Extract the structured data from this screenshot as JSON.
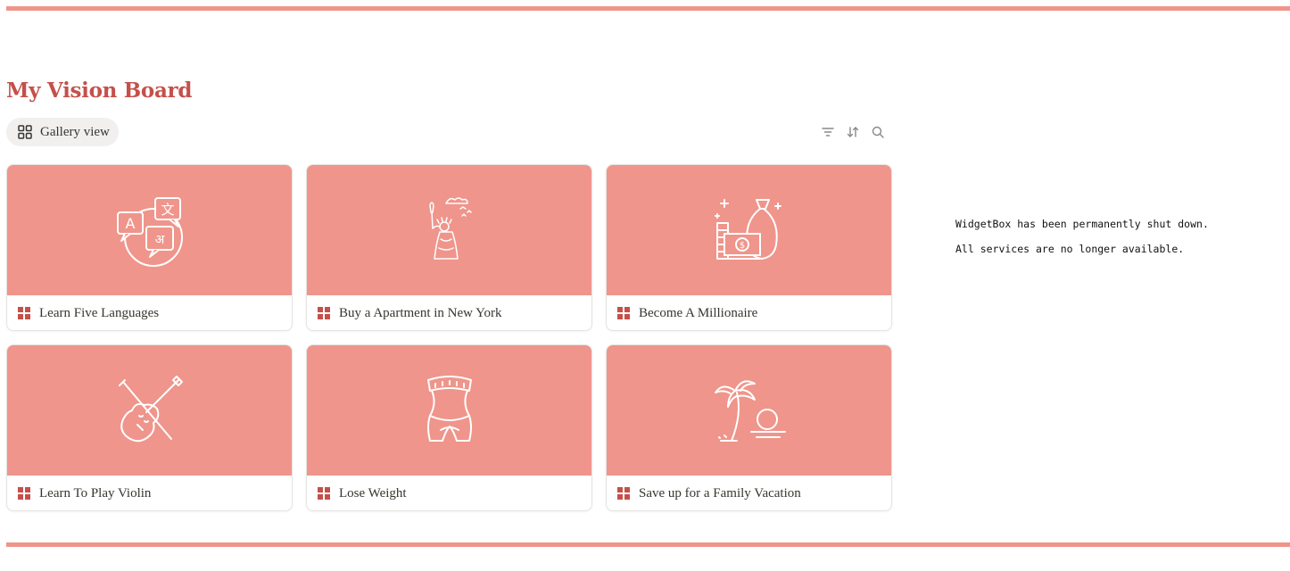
{
  "page": {
    "title": "My Vision Board",
    "accent_color": "#c5504a",
    "cover_color": "#ef958b"
  },
  "view": {
    "label": "Gallery view",
    "icon": "gallery-grid-icon"
  },
  "toolbar": {
    "filter_icon": "filter-icon",
    "sort_icon": "sort-icon",
    "search_icon": "search-icon"
  },
  "cards": [
    {
      "title": "Learn Five Languages",
      "icon": "translate-icon"
    },
    {
      "title": "Buy a Apartment in New York",
      "icon": "statue-of-liberty-icon"
    },
    {
      "title": "Become A Millionaire",
      "icon": "money-bag-icon"
    },
    {
      "title": "Learn To Play Violin",
      "icon": "violin-icon"
    },
    {
      "title": "Lose Weight",
      "icon": "waist-measure-icon"
    },
    {
      "title": "Save up for a Family Vacation",
      "icon": "palm-beach-icon"
    }
  ],
  "widget": {
    "line1": "WidgetBox has been permanently shut down.",
    "line2": "All services are no longer available."
  }
}
